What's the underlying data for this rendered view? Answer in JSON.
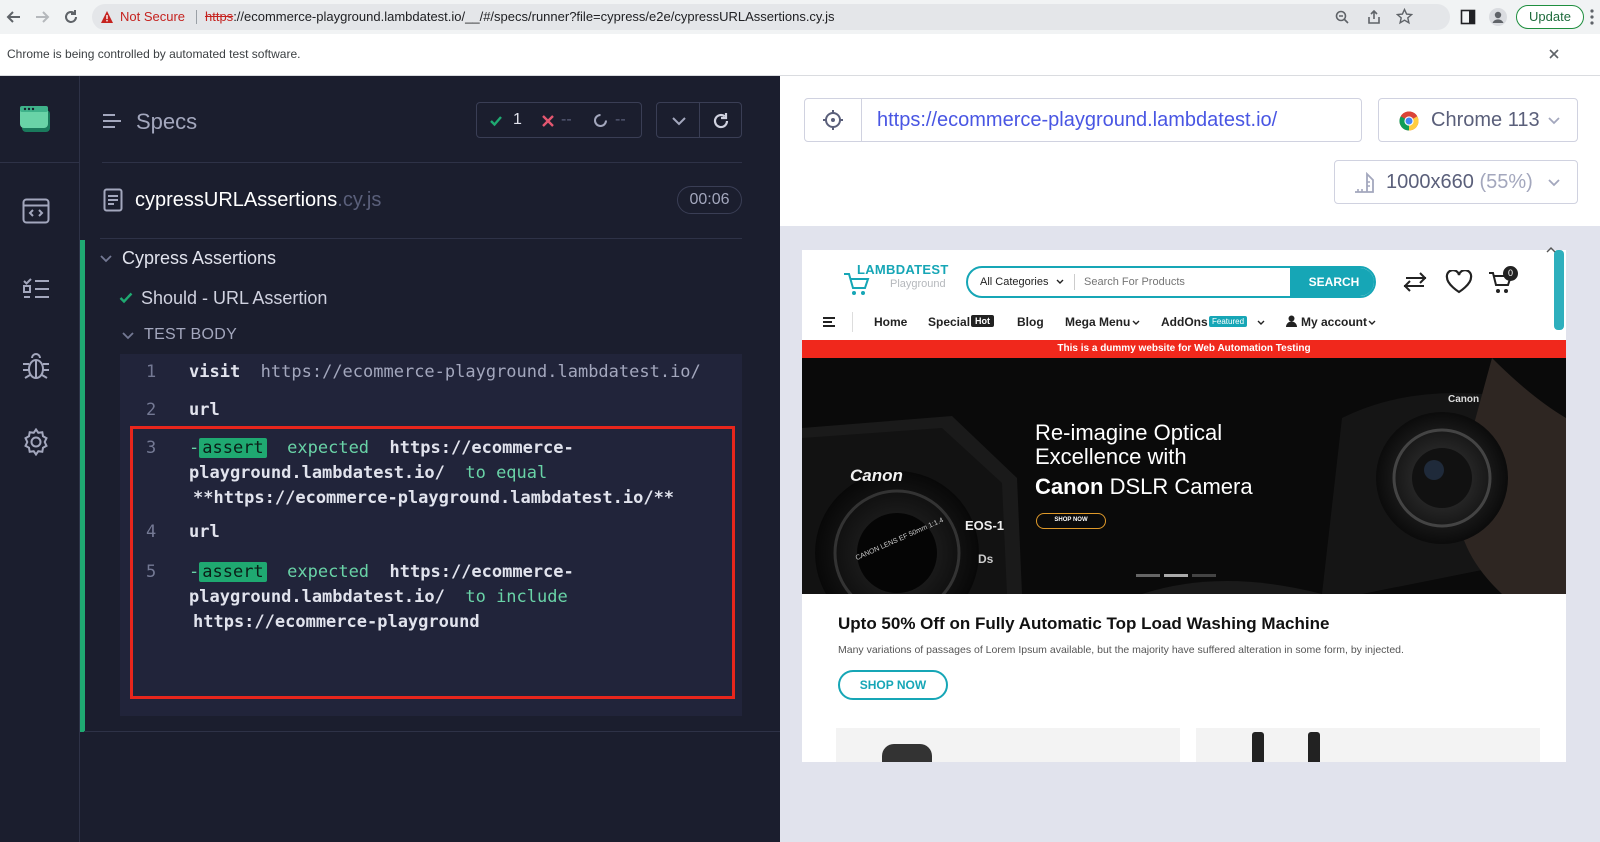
{
  "browser": {
    "security_label": "Not Secure",
    "url_scheme": "https",
    "url_rest": "://ecommerce-playground.lambdatest.io/__/#/specs/runner?file=cypress/e2e/cypressURLAssertions.cy.js",
    "update_label": "Update",
    "automation_notice": "Chrome is being controlled by automated test software."
  },
  "runner": {
    "specs_label": "Specs",
    "passed_count": "1",
    "failed_count": "--",
    "pending_count": "--",
    "spec_name": "cypressURLAssertions",
    "spec_ext": ".cy.js",
    "duration": "00:06",
    "suite_title": "Cypress Assertions",
    "test_title": "Should - URL Assertion",
    "test_body_label": "TEST BODY",
    "commands": [
      {
        "num": "1",
        "name": "visit",
        "arg": "https://ecommerce-playground.lambdatest.io/"
      },
      {
        "num": "2",
        "name": "url"
      },
      {
        "num": "3",
        "tag": "assert",
        "line1_kw": "expected",
        "line1_val": "https://ecommerce-",
        "line2_val": "playground.lambdatest.io/",
        "line2_kw": "to equal",
        "line3": "**https://ecommerce-playground.lambdatest.io/**"
      },
      {
        "num": "4",
        "name": "url"
      },
      {
        "num": "5",
        "tag": "assert",
        "line1_kw": "expected",
        "line1_val": "https://ecommerce-",
        "line2_val": "playground.lambdatest.io/",
        "line2_kw": "to include",
        "line3": "https://ecommerce-playground"
      }
    ]
  },
  "preview": {
    "url": "https://ecommerce-playground.lambdatest.io/",
    "browser_label": "Chrome 113",
    "viewport_size": "1000x660",
    "viewport_scale": "(55%)"
  },
  "site": {
    "logo_title": "LAMBDATEST",
    "logo_sub": "Playground",
    "category_label": "All Categories",
    "search_placeholder": "Search For Products",
    "search_button": "SEARCH",
    "cart_count": "0",
    "nav": {
      "home": "Home",
      "special": "Special",
      "special_badge": "Hot",
      "blog": "Blog",
      "mega_menu": "Mega Menu",
      "addons": "AddOns",
      "addons_badge": "Featured",
      "account": "My account"
    },
    "notice": "This is a dummy website for Web Automation Testing",
    "hero": {
      "line1": "Re-imagine Optical",
      "line2": "Excellence with",
      "brand": "Canon",
      "line3_rest": " DSLR Camera",
      "cta": "SHOP NOW",
      "camera_brand": "Canon",
      "lens_text": "CANON LENS EF 50mm 1:1.4",
      "model_eos": "EOS-1",
      "model_ds": "Ds"
    },
    "promo_title": "Upto 50% Off on Fully Automatic Top Load Washing Machine",
    "promo_text": "Many variations of passages of Lorem Ipsum available, but the majority have suffered alteration in some form, by injected.",
    "promo_cta": "SHOP NOW"
  },
  "colors": {
    "runner_bg": "#1b1e2e",
    "pass_green": "#1fa971",
    "fail_red": "#e45770",
    "highlight_red": "#e8261c",
    "site_teal": "#16a6b6",
    "notice_red": "#f0281c"
  }
}
